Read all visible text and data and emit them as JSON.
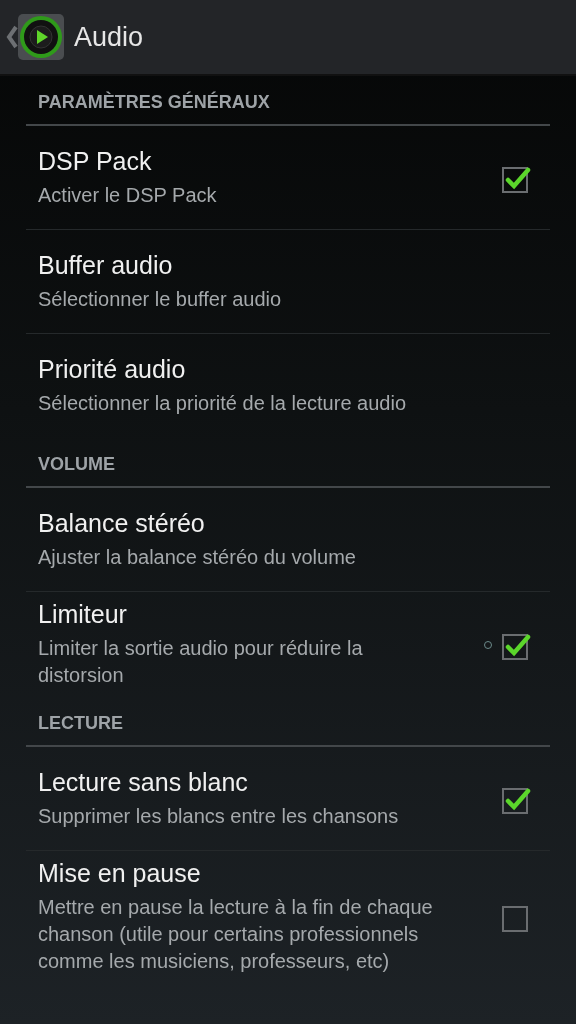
{
  "header": {
    "title": "Audio"
  },
  "sections": [
    {
      "title": "PARAMÈTRES GÉNÉRAUX",
      "items": [
        {
          "kind": "checkbox",
          "title": "DSP Pack",
          "summary": "Activer le DSP Pack",
          "checked": true
        },
        {
          "kind": "plain",
          "title": "Buffer audio",
          "summary": "Sélectionner le buffer audio"
        },
        {
          "kind": "plain",
          "title": "Priorité audio",
          "summary": "Sélectionner la priorité de la lecture audio"
        }
      ]
    },
    {
      "title": "VOLUME",
      "items": [
        {
          "kind": "plain",
          "title": "Balance stéréo",
          "summary": "Ajuster la balance stéréo du volume"
        },
        {
          "kind": "checkbox",
          "title": "Limiteur",
          "summary": "Limiter la sortie audio pour réduire la distorsion",
          "checked": true,
          "indicator": true
        }
      ]
    },
    {
      "title": "LECTURE",
      "items": [
        {
          "kind": "checkbox",
          "title": "Lecture sans blanc",
          "summary": "Supprimer les blancs entre les chansons",
          "checked": true
        },
        {
          "kind": "checkbox",
          "title": "Mise en pause",
          "summary": "Mettre en pause la lecture à la fin de chaque chanson (utile pour certains professionnels comme les musiciens, professeurs, etc)",
          "checked": false
        }
      ]
    }
  ]
}
